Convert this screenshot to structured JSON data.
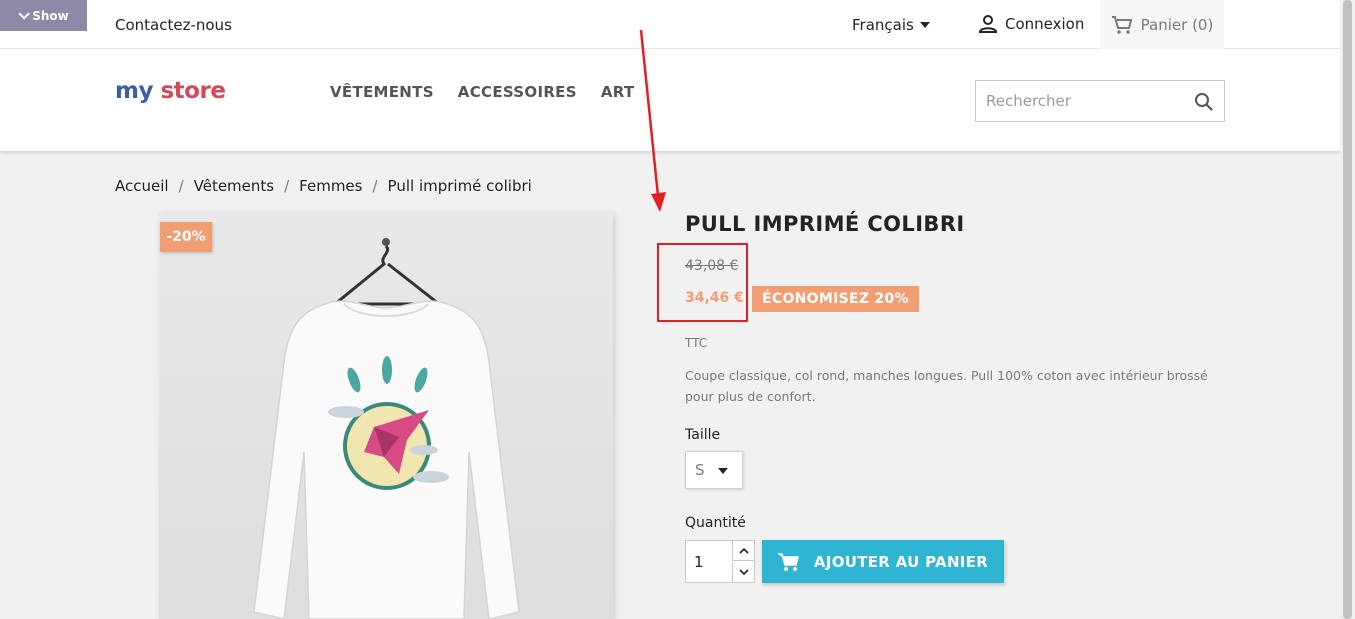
{
  "topbar": {
    "show_label": "Show",
    "contact_label": "Contactez-nous",
    "language": "Français",
    "login_label": "Connexion",
    "cart_label": "Panier (0)"
  },
  "header": {
    "logo_word1": "my",
    "logo_word2": "store",
    "nav": [
      "VÊTEMENTS",
      "ACCESSOIRES",
      "ART"
    ],
    "search_placeholder": "Rechercher"
  },
  "breadcrumb": [
    "Accueil",
    "Vêtements",
    "Femmes",
    "Pull imprimé colibri"
  ],
  "product": {
    "discount_badge": "-20%",
    "title": "PULL IMPRIMÉ COLIBRI",
    "old_price": "43,08 €",
    "new_price": "34,46 €",
    "save_label": "ÉCONOMISEZ 20%",
    "tax_label": "TTC",
    "description": "Coupe classique, col rond, manches longues. Pull 100% coton avec intérieur brossé pour plus de confort.",
    "size_label": "Taille",
    "size_value": "S",
    "quantity_label": "Quantité",
    "quantity_value": "1",
    "add_to_cart_label": "AJOUTER AU PANIER"
  },
  "colors": {
    "accent": "#2fb5d2",
    "sale": "#f39d72",
    "annotation": "#e31e24"
  }
}
